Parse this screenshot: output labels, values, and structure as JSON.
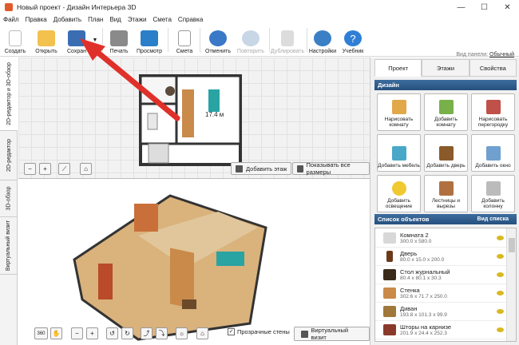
{
  "window": {
    "title": "Новый проект - Дизайн Интерьера 3D",
    "minimize": "—",
    "maximize": "☐",
    "close": "✕"
  },
  "menu": [
    "Файл",
    "Правка",
    "Добавить",
    "План",
    "Вид",
    "Этажи",
    "Смета",
    "Справка"
  ],
  "toolbar": {
    "create": "Создать",
    "open": "Открыть",
    "save": "Сохран",
    "print": "Печать",
    "preview": "Просмотр",
    "estimate": "Смета",
    "undo": "Отменить",
    "redo": "Повторить",
    "duplicate": "Дублировать",
    "settings": "Настройки",
    "tutorial": "Учебник",
    "panel_view_label": "Вид панели:",
    "panel_view_value": "Обычный"
  },
  "left_tabs": [
    "2D-редактор и 3D-обзор",
    "2D-редактор",
    "3D-обзор",
    "Виртуальный визит"
  ],
  "plan": {
    "room_area": "17.4 м",
    "add_floor": "Добавить этаж",
    "show_sizes": "Показывать все размеры"
  },
  "view3d": {
    "transparent_walls": "Прозрачные стены",
    "virtual_visit": "Виртуальный визит",
    "rotate360": "360"
  },
  "right_tabs": [
    "Проект",
    "Этажи",
    "Свойства"
  ],
  "design": {
    "header": "Дизайн",
    "items": [
      "Нарисовать комнату",
      "Добавить комнату",
      "Нарисовать перегородку",
      "Добавить мебель",
      "Добавить дверь",
      "Добавить окно",
      "Добавить освещение",
      "Лестницы и вырезы",
      "Добавить колонну"
    ]
  },
  "objects": {
    "header": "Список объектов",
    "view_list": "Вид списка",
    "items": [
      {
        "name": "Комната 2",
        "dims": "300.0 x 580.0"
      },
      {
        "name": "Дверь",
        "dims": "80.0 x 15.0 x 200.0"
      },
      {
        "name": "Стол журнальный",
        "dims": "80.4 x 80.1 x 30.3"
      },
      {
        "name": "Стенка",
        "dims": "302.6 x 71.7 x 250.0"
      },
      {
        "name": "Диван",
        "dims": "193.8 x 101.3 x 99.9"
      },
      {
        "name": "Шторы на карнизе",
        "dims": "201.9 x 24.4 x 252.3"
      }
    ]
  },
  "colors": {
    "accent": "#26507e",
    "arrow": "#e0302a",
    "wall": "#333333",
    "floor": "#c98a4a"
  }
}
